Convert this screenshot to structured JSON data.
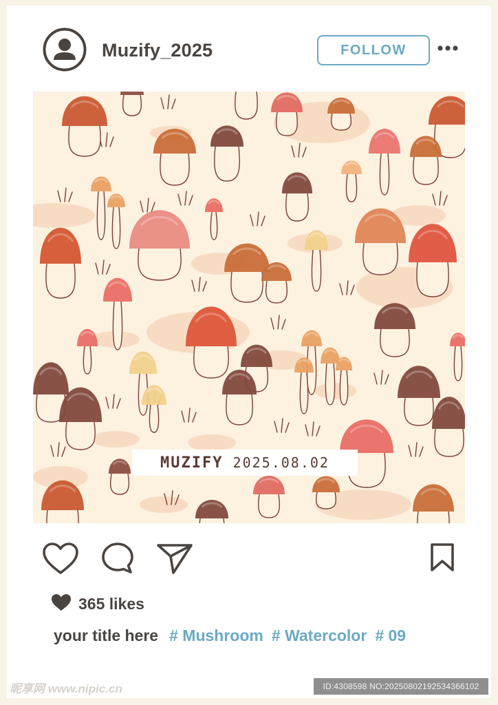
{
  "post": {
    "username": "Muzify_2025",
    "follow_label": "FOLLOW",
    "image_caption_brand": "MUZIFY",
    "image_caption_date": "2025.08.02",
    "likes": "365 likes",
    "title": "your title here",
    "hashtags": [
      "# Mushroom",
      "# Watercolor",
      "# 09"
    ]
  },
  "watermark": {
    "site": "昵享网 www.nipic.cn",
    "id_text": "ID:4308598 NO:20250802192534366102"
  },
  "icons": {
    "avatar": "user-avatar-icon",
    "more": "more-horizontal-icon",
    "like": "heart-outline-icon",
    "comment": "comment-bubble-icon",
    "share": "paper-plane-icon",
    "save": "bookmark-icon",
    "likes_heart": "heart-filled-icon"
  },
  "colors": {
    "text_dark": "#4a4440",
    "accent_blue": "#6aaac4",
    "photo_background": "#fdf1e0",
    "frame_background": "#f7f3e6"
  }
}
